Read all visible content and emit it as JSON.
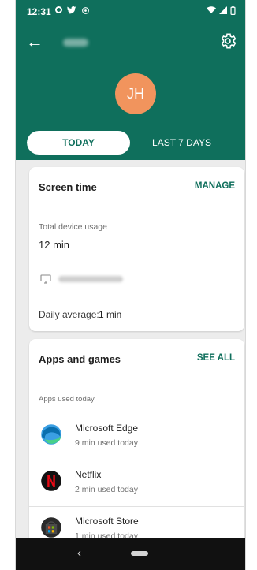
{
  "statusbar": {
    "time": "12:31",
    "icons": [
      "notification-icon",
      "twitter-icon",
      "settings-small-icon",
      "wifi-icon",
      "signal-icon",
      "battery-icon"
    ]
  },
  "header": {
    "background_color": "#0f6f5c",
    "avatar_initials": "JH",
    "avatar_color": "#f1945d"
  },
  "tabs": [
    {
      "label": "TODAY",
      "selected": true
    },
    {
      "label": "LAST 7 DAYS",
      "selected": false
    }
  ],
  "screen_time": {
    "title": "Screen time",
    "action": "MANAGE",
    "total_label": "Total device usage",
    "total_value": "12 min",
    "daily_average_label": "Daily average:",
    "daily_average_value": "1 min"
  },
  "apps": {
    "title": "Apps and games",
    "action": "SEE ALL",
    "subtitle": "Apps used today",
    "items": [
      {
        "name": "Microsoft Edge",
        "time": "9 min used today",
        "icon": "edge-icon"
      },
      {
        "name": "Netflix",
        "time": "2 min used today",
        "icon": "netflix-icon"
      },
      {
        "name": "Microsoft Store",
        "time": "1 min used today",
        "icon": "store-icon"
      }
    ]
  },
  "navbar": {
    "background": "#111111"
  }
}
